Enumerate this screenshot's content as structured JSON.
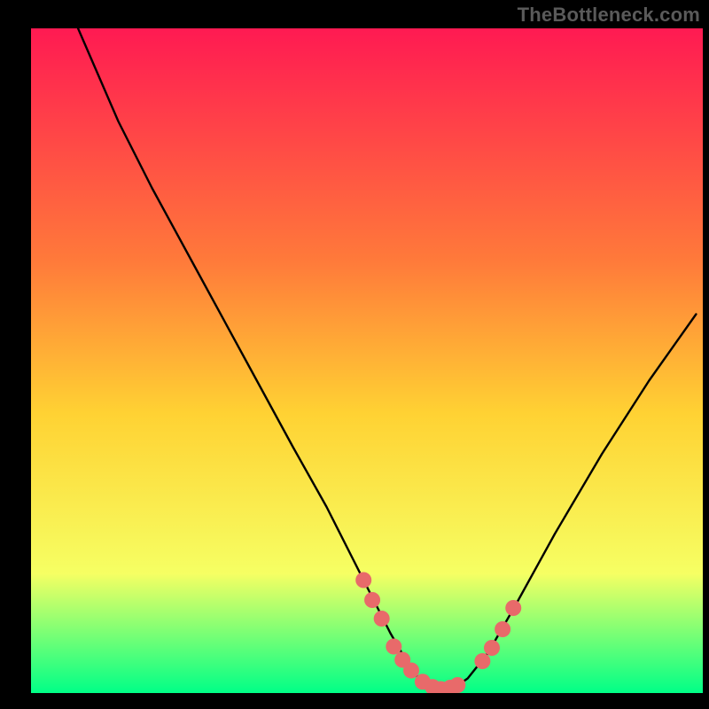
{
  "watermark": "TheBottleneck.com",
  "colors": {
    "bg_black": "#000000",
    "grad_top": "#ff1a52",
    "grad_mid1": "#ff7a3a",
    "grad_mid2": "#ffd233",
    "grad_mid3": "#f6ff63",
    "grad_bottom": "#00ff87",
    "curve": "#000000",
    "markers": "#e86a6a"
  },
  "chart_data": {
    "type": "line",
    "title": "",
    "xlabel": "",
    "ylabel": "",
    "xlim": [
      0,
      100
    ],
    "ylim": [
      0,
      100
    ],
    "grid": false,
    "legend": false,
    "series": [
      {
        "name": "bottleneck-curve",
        "x": [
          7,
          10,
          13,
          18,
          25,
          32,
          39,
          44,
          48,
          51,
          53.5,
          55.5,
          57,
          58.5,
          60,
          61.5,
          63,
          65,
          68,
          72,
          78,
          85,
          92,
          99
        ],
        "y": [
          100,
          93,
          86,
          76,
          63,
          50,
          37,
          28,
          20,
          14,
          9,
          5.5,
          3,
          1.5,
          0.8,
          0.6,
          0.8,
          2.2,
          6,
          13,
          24,
          36,
          47,
          57
        ]
      }
    ],
    "markers": {
      "name": "highlight-points",
      "x": [
        49.5,
        50.8,
        52.2,
        54.0,
        55.3,
        56.6,
        58.3,
        59.8,
        61.0,
        62.4,
        63.5,
        67.2,
        68.6,
        70.2,
        71.8
      ],
      "y": [
        17.0,
        14.0,
        11.2,
        7.0,
        5.0,
        3.4,
        1.7,
        0.9,
        0.6,
        0.8,
        1.2,
        4.8,
        6.8,
        9.6,
        12.8
      ]
    }
  }
}
